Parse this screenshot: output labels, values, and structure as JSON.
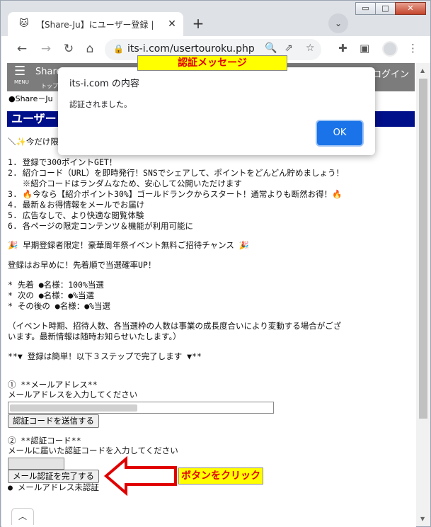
{
  "window": {
    "minimize": "▭",
    "maximize": "□",
    "close": "✕"
  },
  "tab": {
    "title": "【Share-Ju】にユーザー登録 |",
    "close": "✕",
    "new_tab": "+",
    "menu": "⌄"
  },
  "toolbar": {
    "url": "its-i.com/usertouroku.php"
  },
  "site": {
    "menu_label": "MENU",
    "name": "Share",
    "top_label": "トップ",
    "login": "ログイン",
    "breadcrumb": "●Share－Ju",
    "section_title": "ユーザー"
  },
  "content": {
    "line0": "＼✨今だけ限",
    "list": [
      "1. 登録で300ポイントGET！",
      "2. 紹介コード（URL）を即時発行！SNSでシェアして、ポイントをどんどん貯めましょう！",
      "   ※紹介コードはランダムなため、安心して公開いただけます",
      "3. 🔥今なら【紹介ポイント30%】ゴールドランクからスタート！通常よりも断然お得！🔥",
      "4. 最新＆お得情報をメールでお届け",
      "5. 広告なしで、より快適な閲覧体験",
      "6. 各ページの限定コンテンツ＆機能が利用可能に"
    ],
    "campaign": "🎉 早期登録者限定！豪華周年祭イベント無料ご招待チャンス 🎉",
    "apply": "登録はお早めに！先着順で当選確率UP！",
    "tiers": [
      "* 先着 ●名様：100%当選",
      "* 次の ●名様：●%当選",
      "* その後の ●名様：●%当選"
    ],
    "note": [
      "（イベント時期、招待人数、各当選枠の人数は事業の成長度合いにより変動する場合がござ",
      "います。最新情報は随時お知らせいたします。）"
    ],
    "steps_head": "**▼ 登録は簡単！以下３ステップで完了します ▼**",
    "step1_title": "① **メールアドレス**",
    "step1_desc": "メールアドレスを入力してください",
    "send_code": "認証コードを送信する",
    "step2_title": "② **認証コード**",
    "step2_desc": "メールに届いた認証コードを入力してください",
    "complete_btn": "メール認証を完了する",
    "status": "● メールアドレス未認証"
  },
  "dialog": {
    "title": "its-i.com の内容",
    "message": "認証されました。",
    "ok": "OK"
  },
  "annotations": {
    "top": "認証メッセージ",
    "bottom": "ボタンをクリック",
    "arrow_color": "#e00000"
  },
  "colors": {
    "section_bar": "#000f8a",
    "header": "#7c7c7c",
    "ok_button": "#1a73e8"
  }
}
